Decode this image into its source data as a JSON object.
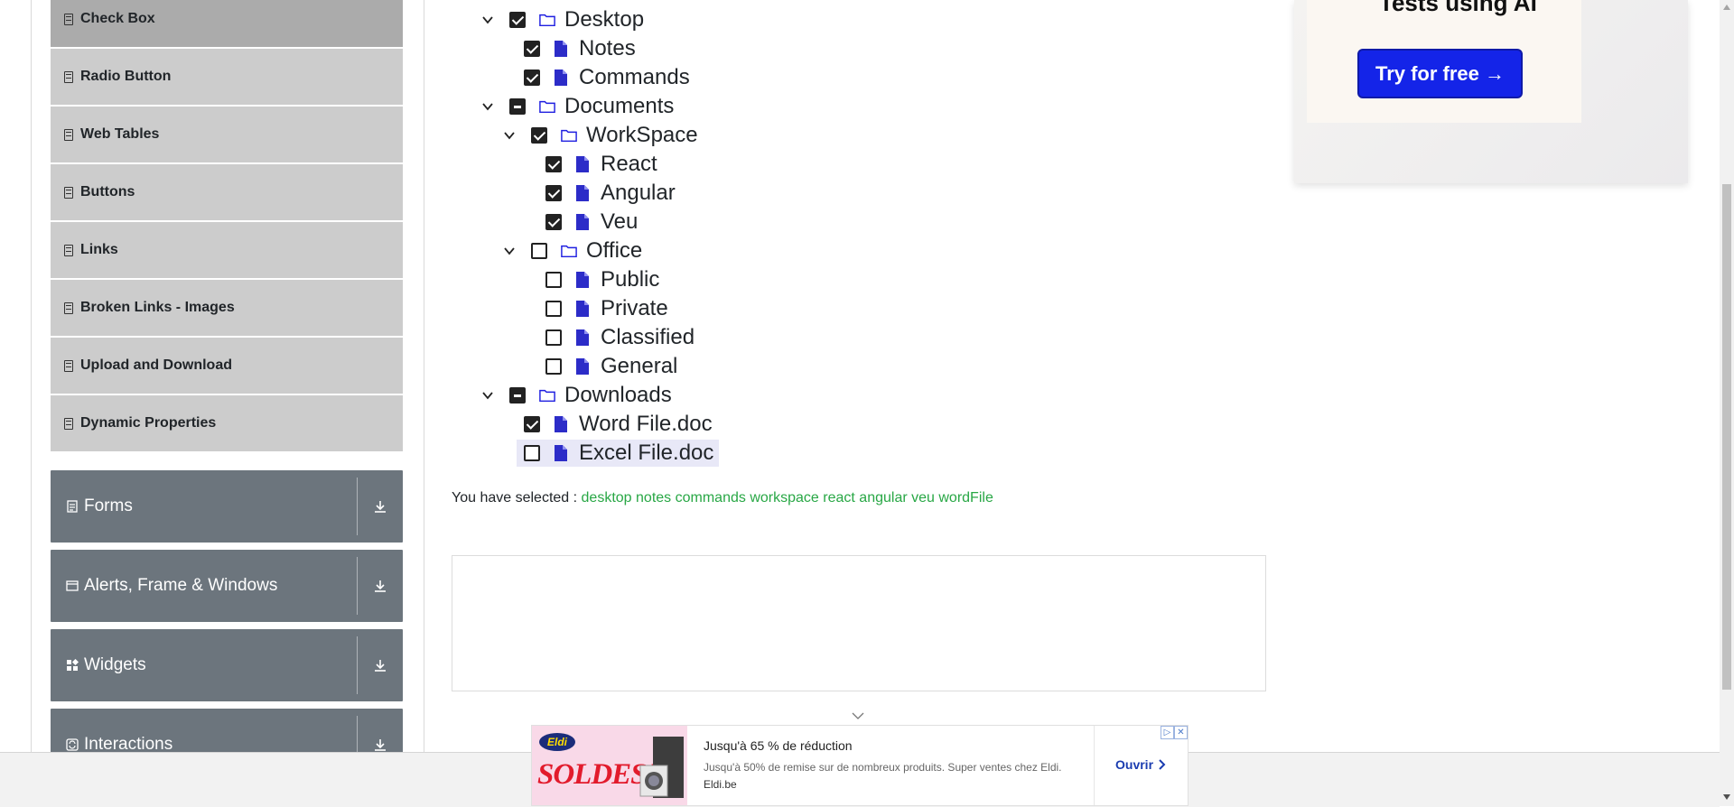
{
  "sidebar": {
    "elements_items": [
      {
        "label": "Check Box",
        "active": true
      },
      {
        "label": "Radio Button"
      },
      {
        "label": "Web Tables"
      },
      {
        "label": "Buttons"
      },
      {
        "label": "Links"
      },
      {
        "label": "Broken Links - Images"
      },
      {
        "label": "Upload and Download"
      },
      {
        "label": "Dynamic Properties"
      }
    ],
    "groups": [
      {
        "label": "Forms",
        "icon": "form-icon"
      },
      {
        "label": "Alerts, Frame & Windows",
        "icon": "window-icon"
      },
      {
        "label": "Widgets",
        "icon": "widgets-icon"
      },
      {
        "label": "Interactions",
        "icon": "interactions-icon"
      }
    ]
  },
  "tree": {
    "desktop": {
      "label": "Desktop",
      "state": "checked",
      "expanded": true
    },
    "notes": {
      "label": "Notes",
      "state": "checked"
    },
    "commands": {
      "label": "Commands",
      "state": "checked"
    },
    "documents": {
      "label": "Documents",
      "state": "half",
      "expanded": true
    },
    "workspace": {
      "label": "WorkSpace",
      "state": "checked",
      "expanded": true
    },
    "react": {
      "label": "React",
      "state": "checked"
    },
    "angular": {
      "label": "Angular",
      "state": "checked"
    },
    "veu": {
      "label": "Veu",
      "state": "checked"
    },
    "office": {
      "label": "Office",
      "state": "unchecked",
      "expanded": true
    },
    "public": {
      "label": "Public",
      "state": "unchecked"
    },
    "private": {
      "label": "Private",
      "state": "unchecked"
    },
    "classified": {
      "label": "Classified",
      "state": "unchecked"
    },
    "general": {
      "label": "General",
      "state": "unchecked"
    },
    "downloads": {
      "label": "Downloads",
      "state": "half",
      "expanded": true
    },
    "wordfile": {
      "label": "Word File.doc",
      "state": "checked"
    },
    "excelfile": {
      "label": "Excel File.doc",
      "state": "unchecked",
      "highlighted": true
    }
  },
  "result": {
    "prefix": "You have selected :",
    "items": [
      "desktop",
      "notes",
      "commands",
      "workspace",
      "react",
      "angular",
      "veu",
      "wordFile"
    ]
  },
  "right_ad": {
    "heading": "Tests using AI",
    "button": "Try for free →"
  },
  "banner_ad": {
    "logo": "Eldi",
    "image_text": "SOLDES!",
    "title": "Jusqu'à 65 % de réduction",
    "subtitle": "Jusqu'à 50% de remise sur de nombreux produits. Super ventes chez Eldi.",
    "domain": "Eldi.be",
    "cta": "Ouvrir"
  },
  "colors": {
    "menu_bg": "#cccccc",
    "menu_active_bg": "#ababab",
    "group_bg": "#6c757d",
    "folder_icon": "#1f1fe0",
    "file_icon": "#2c2cc8",
    "selection_text": "#28a745",
    "ad_button": "#1424e8"
  }
}
